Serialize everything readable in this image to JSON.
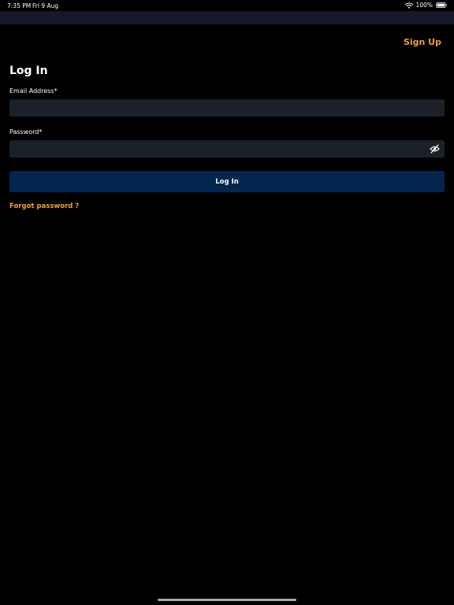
{
  "status_bar": {
    "time": "7:35 PM",
    "date": "Fri 9 Aug",
    "battery": "100%",
    "wifi_icon": "wifi-icon",
    "battery_icon": "battery-icon"
  },
  "header": {
    "signup_label": "Sign Up"
  },
  "login_form": {
    "title": "Log In",
    "email_label": "Email Address*",
    "email_value": "",
    "password_label": "Password*",
    "password_value": "",
    "password_toggle_icon": "eye-slash-icon",
    "submit_label": "Log In",
    "forgot_label": "Forgot password ?"
  },
  "colors": {
    "background": "#000000",
    "nav_bar": "#161a28",
    "accent": "#f0a030",
    "input_bg": "#1b2129",
    "button_bg": "#03264f"
  }
}
